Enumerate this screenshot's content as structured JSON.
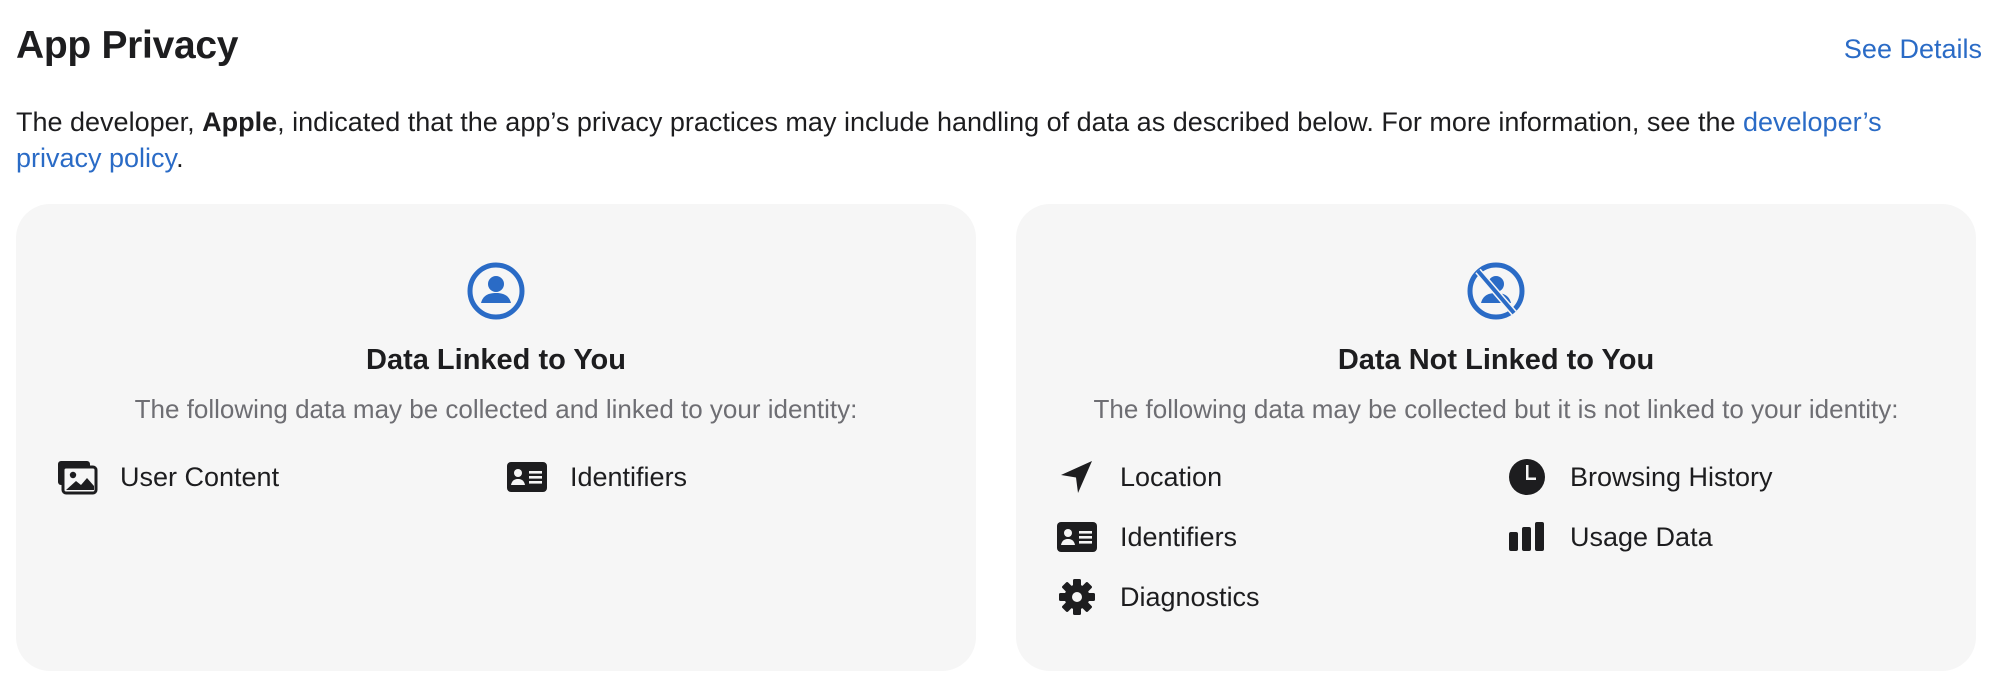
{
  "header": {
    "title": "App Privacy",
    "see_details": "See Details"
  },
  "description": {
    "prefix": "The developer, ",
    "developer": "Apple",
    "middle": ", indicated that the app’s privacy practices may include handling of data as described below. For more information, see the ",
    "link": "developer’s privacy policy",
    "suffix": "."
  },
  "colors": {
    "accent": "#2a6bc6",
    "card_bg": "#f6f6f6",
    "text": "#1d1d1f",
    "secondary_text": "#6e6e73"
  },
  "cards": [
    {
      "icon": "person-circle-icon",
      "title": "Data Linked to You",
      "subtitle": "The following data may be collected and linked to your identity:",
      "items": [
        {
          "icon": "photos-icon",
          "label": "User Content"
        },
        {
          "icon": "id-card-icon",
          "label": "Identifiers"
        }
      ]
    },
    {
      "icon": "person-slash-circle-icon",
      "title": "Data Not Linked to You",
      "subtitle": "The following data may be collected but it is not linked to your identity:",
      "items": [
        {
          "icon": "location-arrow-icon",
          "label": "Location"
        },
        {
          "icon": "clock-icon",
          "label": "Browsing History"
        },
        {
          "icon": "id-card-icon",
          "label": "Identifiers"
        },
        {
          "icon": "bar-chart-icon",
          "label": "Usage Data"
        },
        {
          "icon": "gear-icon",
          "label": "Diagnostics"
        }
      ]
    }
  ]
}
